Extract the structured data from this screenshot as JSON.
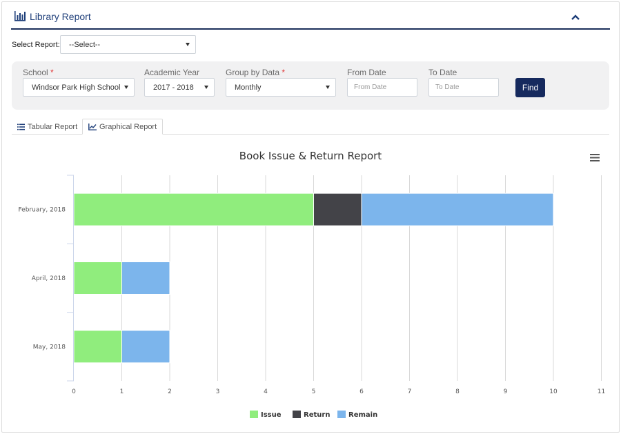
{
  "header": {
    "title": "Library Report",
    "icon": "bar-chart-icon",
    "collapse_icon": "chevron-up-icon"
  },
  "select_report": {
    "label": "Select Report:",
    "value": "--Select--"
  },
  "filters": {
    "school": {
      "label": "School",
      "required_mark": "*",
      "value": "Windsor Park High School"
    },
    "academic_year": {
      "label": "Academic Year",
      "value": "2017 - 2018"
    },
    "group_by": {
      "label": "Group by Data",
      "required_mark": "*",
      "value": "Monthly"
    },
    "from_date": {
      "label": "From Date",
      "placeholder": "From Date"
    },
    "to_date": {
      "label": "To Date",
      "placeholder": "To Date"
    },
    "find_label": "Find"
  },
  "tabs": [
    {
      "label": "Tabular Report",
      "icon": "list-icon",
      "active": false
    },
    {
      "label": "Graphical Report",
      "icon": "line-chart-icon",
      "active": true
    }
  ],
  "colors": {
    "accent": "#162a5e",
    "issue": "#90ed7d",
    "return": "#434348",
    "remain": "#7cb5ec"
  },
  "chart_data": {
    "type": "bar",
    "orientation": "horizontal",
    "stacked": true,
    "title": "Book Issue & Return Report",
    "categories": [
      "February, 2018",
      "April, 2018",
      "May, 2018"
    ],
    "series": [
      {
        "name": "Issue",
        "values": [
          5,
          1,
          1
        ],
        "color": "#90ed7d"
      },
      {
        "name": "Return",
        "values": [
          1,
          0,
          0
        ],
        "color": "#434348"
      },
      {
        "name": "Remain",
        "values": [
          4,
          1,
          1
        ],
        "color": "#7cb5ec"
      }
    ],
    "xlim": [
      0,
      11
    ],
    "xticks": [
      "0",
      "1",
      "2",
      "3",
      "4",
      "5",
      "6",
      "7",
      "8",
      "9",
      "10",
      "11"
    ],
    "grid": true,
    "legend": "bottom-center",
    "menu_icon": "hamburger-menu-icon"
  }
}
